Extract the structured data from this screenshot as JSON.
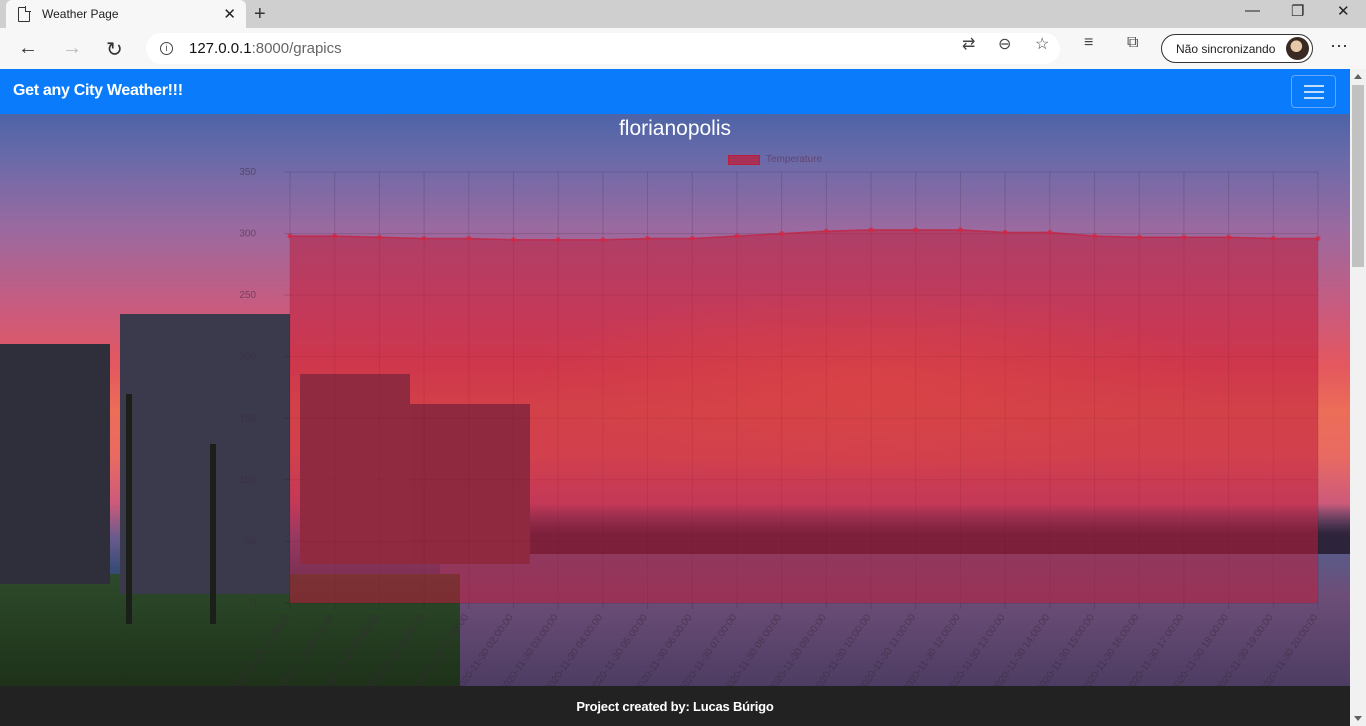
{
  "browser": {
    "tab_title": "Weather Page",
    "url_host": "127.0.0.1",
    "url_rest": ":8000/grapics",
    "sync_label": "Não sincronizando"
  },
  "page": {
    "brand": "Get any City Weather!!!",
    "footer": "Project created by: Lucas Búrigo"
  },
  "colors": {
    "navbar": "#0a7cfb",
    "footer": "#222222",
    "series_fill": "rgba(190,30,60,0.55)"
  },
  "chart_data": {
    "type": "area",
    "title": "florianopolis",
    "legend": "Temperature",
    "legend_position": "top",
    "ylim": [
      0,
      350
    ],
    "yticks": [
      0,
      50,
      100,
      150,
      200,
      250,
      300,
      350
    ],
    "grid": true,
    "x_tick_labels": [
      "2020-11-29 21:00:00",
      "2020-11-29 22:00:00",
      "2020-11-29 23:00:00",
      "2020-11-30 00:00:00",
      "2020-11-30 01:00:00",
      "2020-11-30 02:00:00",
      "2020-11-30 03:00:00",
      "2020-11-30 04:00:00",
      "2020-11-30 05:00:00",
      "2020-11-30 06:00:00",
      "2020-11-30 07:00:00",
      "2020-11-30 08:00:00",
      "2020-11-30 09:00:00",
      "2020-11-30 10:00:00",
      "2020-11-30 11:00:00",
      "2020-11-30 12:00:00",
      "2020-11-30 13:00:00",
      "2020-11-30 14:00:00",
      "2020-11-30 15:00:00",
      "2020-11-30 16:00:00",
      "2020-11-30 17:00:00",
      "2020-11-30 18:00:00",
      "2020-11-30 19:00:00",
      "2020-11-30 20:00:00"
    ],
    "values": [
      298,
      298,
      297,
      296,
      296,
      295,
      295,
      295,
      296,
      296,
      298,
      300,
      302,
      303,
      303,
      303,
      301,
      301,
      298,
      297,
      297,
      297,
      296,
      296
    ]
  }
}
